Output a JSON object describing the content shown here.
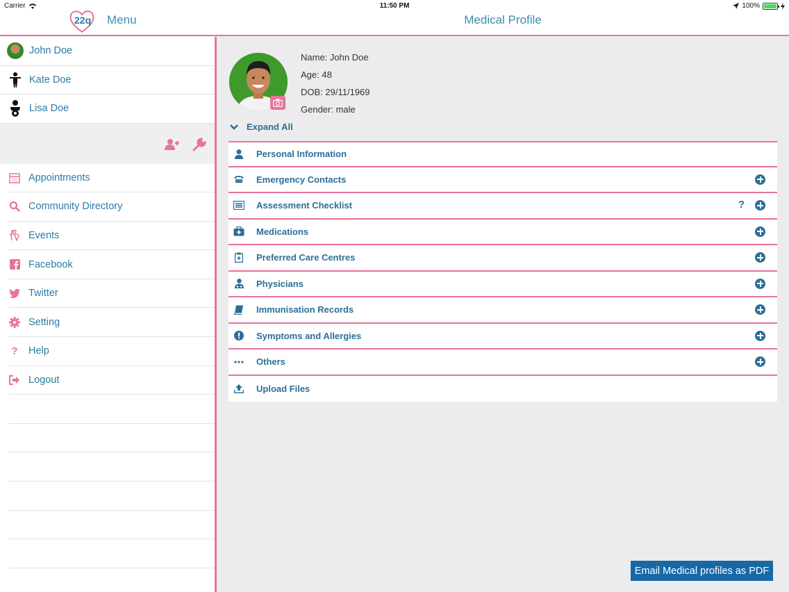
{
  "status_bar": {
    "carrier": "Carrier",
    "time": "11:50 PM",
    "battery": "100%"
  },
  "nav": {
    "menu_title": "Menu",
    "page_title": "Medical Profile"
  },
  "profiles": [
    {
      "name": "John Doe",
      "icon": "avatar-photo"
    },
    {
      "name": "Kate Doe",
      "icon": "child-icon"
    },
    {
      "name": "Lisa Doe",
      "icon": "baby-icon"
    }
  ],
  "menu": [
    {
      "label": "Appointments",
      "icon": "calendar-icon"
    },
    {
      "label": "Community Directory",
      "icon": "search-icon"
    },
    {
      "label": "Events",
      "icon": "hand-icon"
    },
    {
      "label": "Facebook",
      "icon": "facebook-icon"
    },
    {
      "label": "Twitter",
      "icon": "twitter-icon"
    },
    {
      "label": "Setting",
      "icon": "gear-icon"
    },
    {
      "label": "Help",
      "icon": "question-icon"
    },
    {
      "label": "Logout",
      "icon": "logout-icon"
    }
  ],
  "patient": {
    "name": "Name: John Doe",
    "age": "Age: 48",
    "dob": "DOB: 29/11/1969",
    "gender": "Gender: male"
  },
  "expand_all": "Expand All",
  "sections": [
    {
      "label": "Personal Information",
      "icon": "person-icon",
      "expandable": false
    },
    {
      "label": "Emergency Contacts",
      "icon": "phone-icon",
      "expandable": true
    },
    {
      "label": "Assessment Checklist",
      "icon": "checklist-icon",
      "expandable": true,
      "help": "?"
    },
    {
      "label": "Medications",
      "icon": "medkit-icon",
      "expandable": true
    },
    {
      "label": "Preferred Care Centres",
      "icon": "clipboard-icon",
      "expandable": true
    },
    {
      "label": "Physicians",
      "icon": "doctor-icon",
      "expandable": true
    },
    {
      "label": "Immunisation Records",
      "icon": "book-icon",
      "expandable": true
    },
    {
      "label": "Symptoms and Allergies",
      "icon": "exclamation-icon",
      "expandable": true
    },
    {
      "label": "Others",
      "icon": "ellipsis-icon",
      "expandable": true
    },
    {
      "label": "Upload Files",
      "icon": "upload-icon",
      "expandable": false
    }
  ],
  "email_button": "Email Medical profiles as PDF",
  "colors": {
    "accent_pink": "#e8739a",
    "link_blue": "#2b7ca6",
    "button_blue": "#1769a6"
  }
}
